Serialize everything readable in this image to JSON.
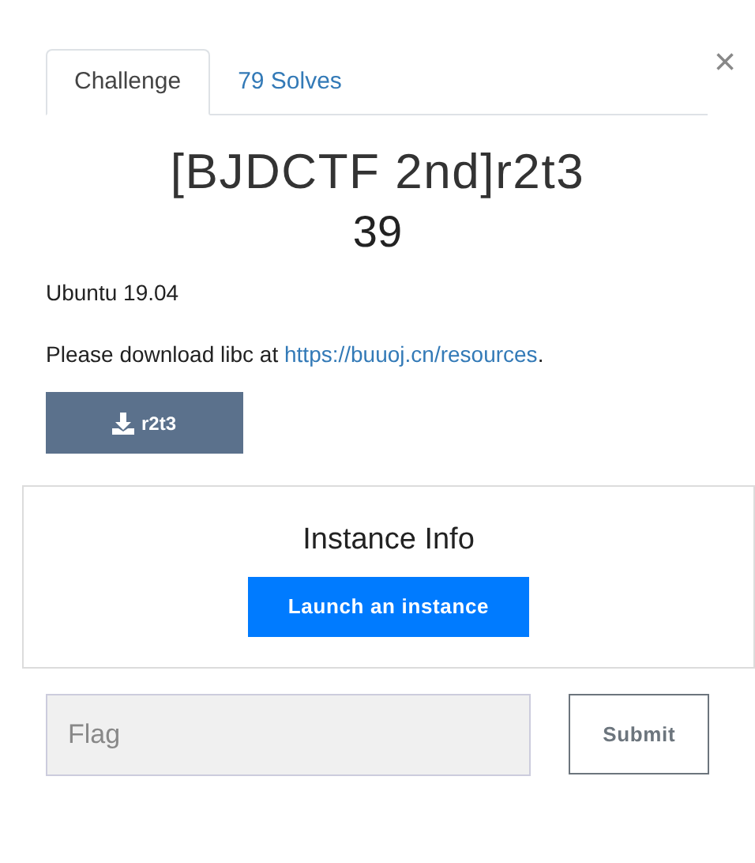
{
  "tabs": [
    {
      "label": "Challenge",
      "selected": true
    },
    {
      "label": "79 Solves",
      "selected": false
    }
  ],
  "close": "×",
  "title": "[BJDCTF 2nd]r2t3",
  "points": "39",
  "description": [
    {
      "kind": "text",
      "text": "Ubuntu 19.04"
    },
    {
      "kind": "link_paragraph",
      "before": "Please download libc at ",
      "link": "https://buuoj.cn/resources",
      "after": "."
    }
  ],
  "download": {
    "label": "r2t3"
  },
  "instance": {
    "title": "Instance Info",
    "button": "Launch an instance"
  },
  "flag": {
    "placeholder": "Flag"
  },
  "submit": "Submit"
}
